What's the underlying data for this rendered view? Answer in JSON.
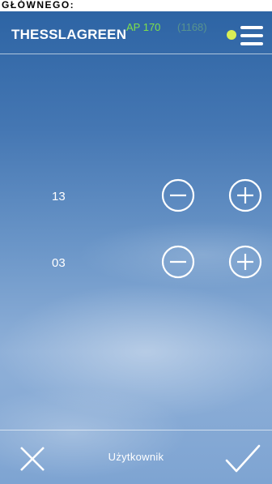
{
  "caption": {
    "text": "GŁÓWNEGO:"
  },
  "header": {
    "brand": "THESSLAGREEN",
    "model": "AP 170",
    "code": "(1168)",
    "status_color": "#d9ee55",
    "menu_icon": "hamburger-icon"
  },
  "rows": [
    {
      "value": "13",
      "minus_icon": "minus-circle-icon",
      "plus_icon": "plus-circle-icon"
    },
    {
      "value": "03",
      "minus_icon": "minus-circle-icon",
      "plus_icon": "plus-circle-icon"
    }
  ],
  "footer": {
    "label": "Użytkownik",
    "cancel_icon": "close-icon",
    "confirm_icon": "check-icon"
  },
  "colors": {
    "brand_accent": "#7ee04a",
    "foreground": "#ffffff"
  }
}
